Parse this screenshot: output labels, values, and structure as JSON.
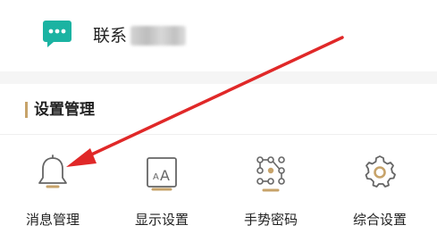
{
  "contact": {
    "label": "联系",
    "icon": "chat-bubble-icon",
    "icon_color": "#1bb3a2"
  },
  "settings_section": {
    "title": "设置管理",
    "accent_color": "#c7a36a"
  },
  "items": [
    {
      "label": "消息管理",
      "icon": "bell-icon"
    },
    {
      "label": "显示设置",
      "icon": "font-size-icon"
    },
    {
      "label": "手势密码",
      "icon": "gesture-pattern-icon"
    },
    {
      "label": "综合设置",
      "icon": "gear-icon"
    }
  ],
  "annotation": {
    "arrow_color": "#e02828"
  }
}
